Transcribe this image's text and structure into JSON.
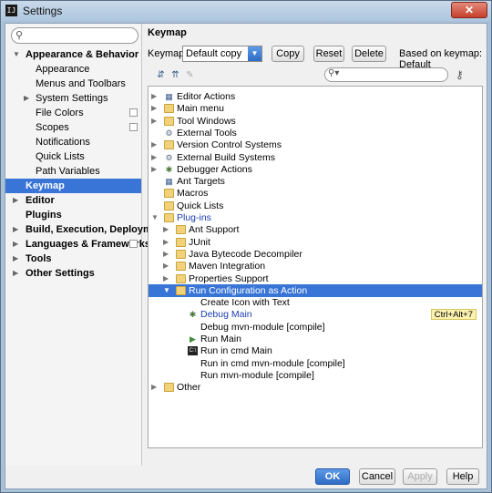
{
  "window": {
    "title": "Settings",
    "app_icon": "intellij-icon",
    "close": "✕"
  },
  "sidebar": {
    "search_placeholder": "",
    "items": [
      {
        "label": "Appearance & Behavior",
        "bold": true,
        "expanded": true,
        "level": 0
      },
      {
        "label": "Appearance",
        "level": 1
      },
      {
        "label": "Menus and Toolbars",
        "level": 1
      },
      {
        "label": "System Settings",
        "level": 1,
        "has_children": true
      },
      {
        "label": "File Colors",
        "level": 1,
        "project_icon": true
      },
      {
        "label": "Scopes",
        "level": 1,
        "project_icon": true
      },
      {
        "label": "Notifications",
        "level": 1
      },
      {
        "label": "Quick Lists",
        "level": 1
      },
      {
        "label": "Path Variables",
        "level": 1
      },
      {
        "label": "Keymap",
        "bold": true,
        "selected": true,
        "level": 0
      },
      {
        "label": "Editor",
        "bold": true,
        "has_children": true,
        "level": 0
      },
      {
        "label": "Plugins",
        "bold": true,
        "level": 0
      },
      {
        "label": "Build, Execution, Deployment",
        "bold": true,
        "has_children": true,
        "level": 0
      },
      {
        "label": "Languages & Frameworks",
        "bold": true,
        "has_children": true,
        "level": 0,
        "project_icon": true
      },
      {
        "label": "Tools",
        "bold": true,
        "has_children": true,
        "level": 0
      },
      {
        "label": "Other Settings",
        "bold": true,
        "has_children": true,
        "level": 0
      }
    ]
  },
  "keymap": {
    "heading": "Keymap",
    "keymaps_label": "Keymaps:",
    "selected_keymap": "Default copy",
    "copy_label": "Copy",
    "reset_label": "Reset",
    "delete_label": "Delete",
    "based_on": "Based on keymap: Default",
    "filter_placeholder": "",
    "tree": [
      {
        "label": "Editor Actions",
        "icon": "action",
        "arrow": "collapsed",
        "level": 0
      },
      {
        "label": "Main menu",
        "icon": "folder",
        "arrow": "collapsed",
        "level": 0
      },
      {
        "label": "Tool Windows",
        "icon": "folder",
        "arrow": "collapsed",
        "level": 0
      },
      {
        "label": "External Tools",
        "icon": "gear",
        "arrow": "none",
        "level": 0
      },
      {
        "label": "Version Control Systems",
        "icon": "folder",
        "arrow": "collapsed",
        "level": 0
      },
      {
        "label": "External Build Systems",
        "icon": "gear",
        "arrow": "collapsed",
        "level": 0
      },
      {
        "label": "Debugger Actions",
        "icon": "debug",
        "arrow": "collapsed",
        "level": 0
      },
      {
        "label": "Ant Targets",
        "icon": "action",
        "arrow": "none",
        "level": 0
      },
      {
        "label": "Macros",
        "icon": "folder",
        "arrow": "none",
        "level": 0
      },
      {
        "label": "Quick Lists",
        "icon": "folder",
        "arrow": "none",
        "level": 0
      },
      {
        "label": "Plug-ins",
        "icon": "folder",
        "arrow": "expanded",
        "level": 0,
        "link": true
      },
      {
        "label": "Ant Support",
        "icon": "folder",
        "arrow": "collapsed",
        "level": 1
      },
      {
        "label": "JUnit",
        "icon": "folder",
        "arrow": "collapsed",
        "level": 1
      },
      {
        "label": "Java Bytecode Decompiler",
        "icon": "folder",
        "arrow": "collapsed",
        "level": 1
      },
      {
        "label": "Maven Integration",
        "icon": "folder",
        "arrow": "collapsed",
        "level": 1
      },
      {
        "label": "Properties Support",
        "icon": "folder",
        "arrow": "collapsed",
        "level": 1
      },
      {
        "label": "Run Configuration as Action",
        "icon": "folder",
        "arrow": "expanded",
        "level": 1,
        "selected": true
      },
      {
        "label": "Create Icon with Text",
        "icon": "none",
        "arrow": "none",
        "level": 2
      },
      {
        "label": "Debug Main",
        "icon": "debug",
        "arrow": "none",
        "level": 2,
        "link": true,
        "shortcut": "Ctrl+Alt+7"
      },
      {
        "label": "Debug mvn-module [compile]",
        "icon": "none",
        "arrow": "none",
        "level": 2
      },
      {
        "label": "Run Main",
        "icon": "run",
        "arrow": "none",
        "level": 2
      },
      {
        "label": "Run in cmd Main",
        "icon": "cmd",
        "arrow": "none",
        "level": 2
      },
      {
        "label": "Run in cmd mvn-module [compile]",
        "icon": "none",
        "arrow": "none",
        "level": 2
      },
      {
        "label": "Run mvn-module [compile]",
        "icon": "none",
        "arrow": "none",
        "level": 2
      },
      {
        "label": "Other",
        "icon": "folder",
        "arrow": "collapsed",
        "level": 0
      }
    ]
  },
  "footer": {
    "ok": "OK",
    "cancel": "Cancel",
    "apply": "Apply",
    "help": "Help"
  }
}
